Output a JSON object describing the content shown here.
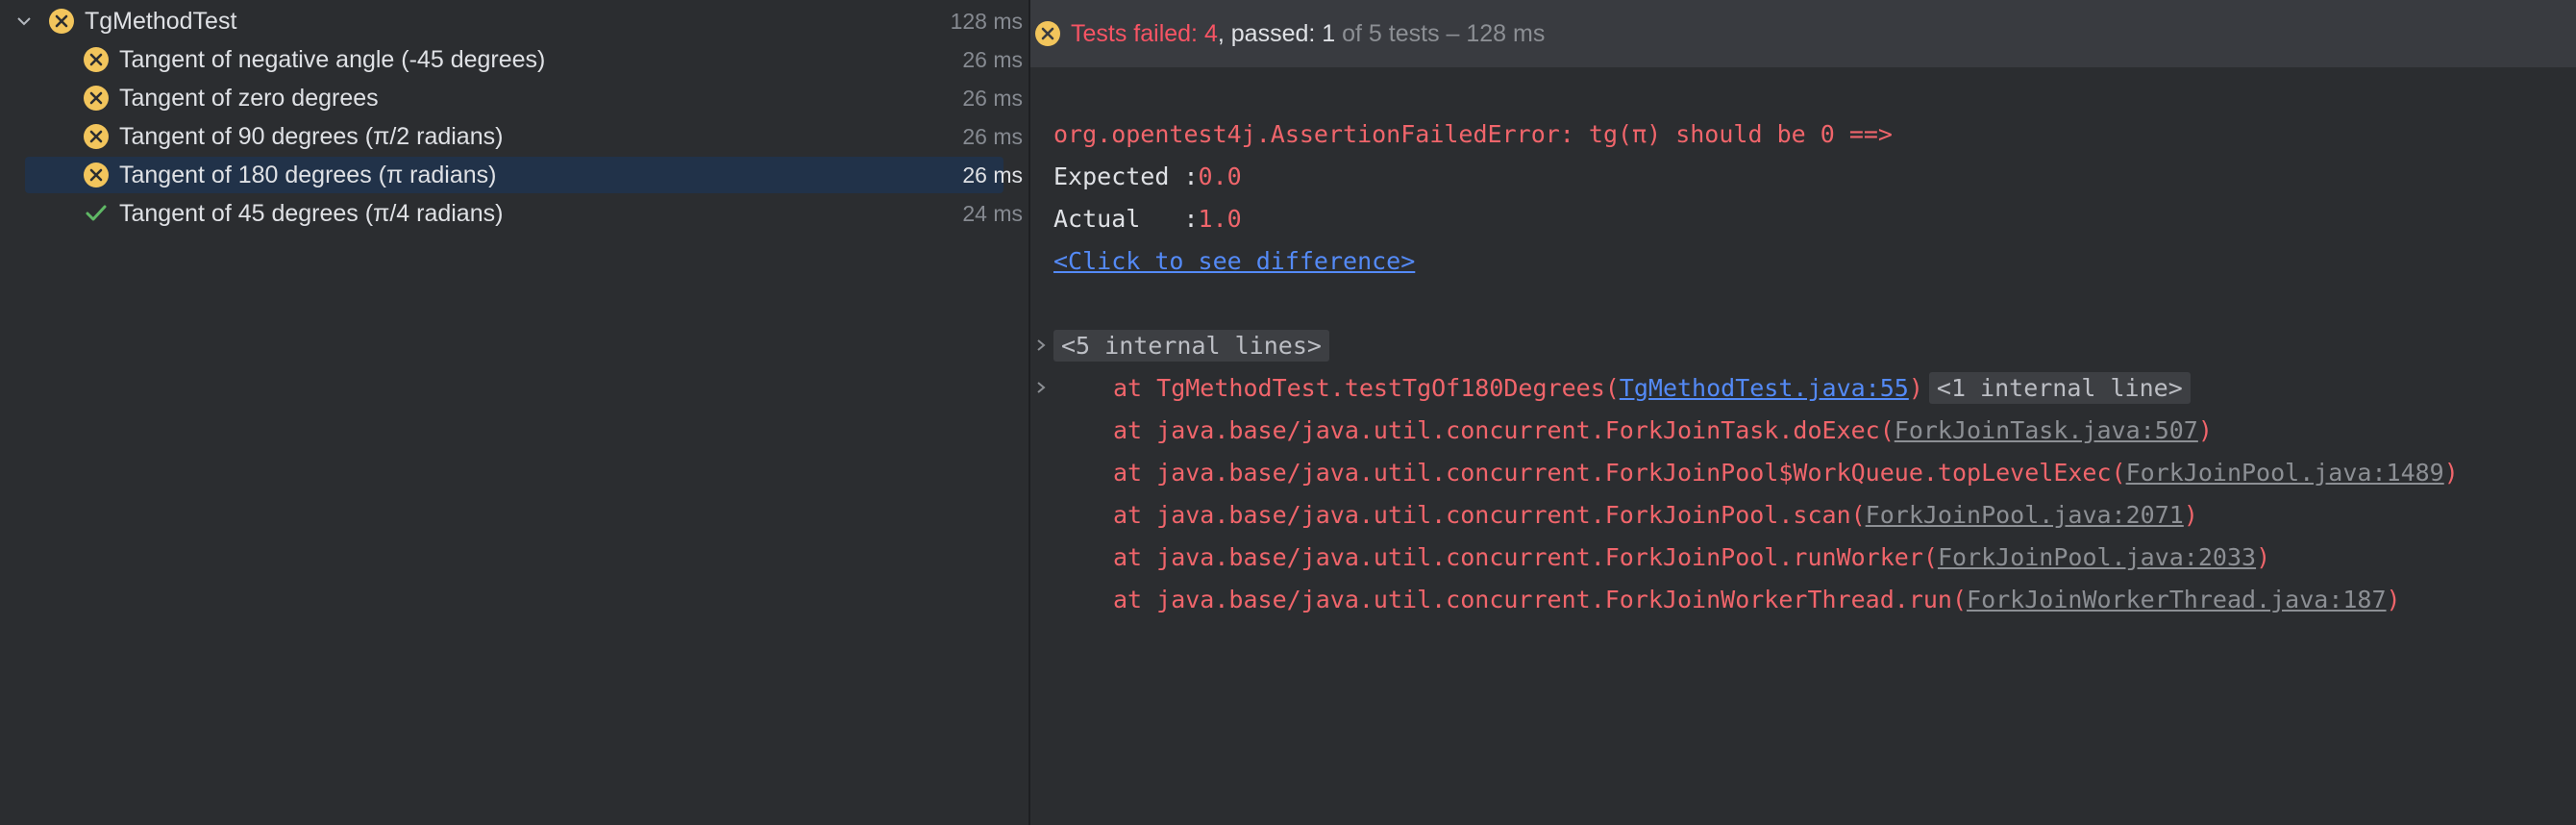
{
  "tree": {
    "root": {
      "label": "TgMethodTest",
      "time": "128 ms",
      "status": "failed",
      "icon": "chevron-down-icon"
    },
    "items": [
      {
        "label": "Tangent of negative angle (-45 degrees)",
        "time": "26 ms",
        "status": "failed"
      },
      {
        "label": "Tangent of zero degrees",
        "time": "26 ms",
        "status": "failed"
      },
      {
        "label": "Tangent of 90 degrees (π/2 radians)",
        "time": "26 ms",
        "status": "failed"
      },
      {
        "label": "Tangent of 180 degrees (π radians)",
        "time": "26 ms",
        "status": "failed",
        "selected": true
      },
      {
        "label": "Tangent of 45 degrees (π/4 radians)",
        "time": "24 ms",
        "status": "passed"
      }
    ]
  },
  "status_bar": {
    "failed_text": "Tests failed: 4",
    "separator": ", ",
    "passed_text": "passed: 1",
    "summary_text": " of 5 tests – 128 ms"
  },
  "console": {
    "error_line": "org.opentest4j.AssertionFailedError: tg(π) should be 0 ==>",
    "expected_label": "Expected :",
    "expected_value": "0.0",
    "actual_label": "Actual   :",
    "actual_value": "1.0",
    "diff_link": "<Click to see difference>",
    "folded_internal": "<5 internal lines>",
    "stack": [
      {
        "prefix": "at TgMethodTest.testTgOf180Degrees(",
        "link": "TgMethodTest.java:55",
        "suffix": ")",
        "folded": "<1 internal line>",
        "link_style": "primary"
      },
      {
        "prefix": "at java.base/java.util.concurrent.ForkJoinTask.doExec(",
        "link": "ForkJoinTask.java:507",
        "suffix": ")",
        "link_style": "secondary"
      },
      {
        "prefix": "at java.base/java.util.concurrent.ForkJoinPool$WorkQueue.topLevelExec(",
        "link": "ForkJoinPool.java:1489",
        "suffix": ")",
        "link_style": "secondary"
      },
      {
        "prefix": "at java.base/java.util.concurrent.ForkJoinPool.scan(",
        "link": "ForkJoinPool.java:2071",
        "suffix": ")",
        "link_style": "secondary"
      },
      {
        "prefix": "at java.base/java.util.concurrent.ForkJoinPool.runWorker(",
        "link": "ForkJoinPool.java:2033",
        "suffix": ")",
        "link_style": "secondary"
      },
      {
        "prefix": "at java.base/java.util.concurrent.ForkJoinWorkerThread.run(",
        "link": "ForkJoinWorkerThread.java:187",
        "suffix": ")",
        "link_style": "secondary"
      }
    ]
  },
  "colors": {
    "failed_icon": "#f2c55c",
    "passed_icon": "#5fb865",
    "error_text": "#f0656b",
    "link": "#548af7",
    "selection": "#213249"
  }
}
